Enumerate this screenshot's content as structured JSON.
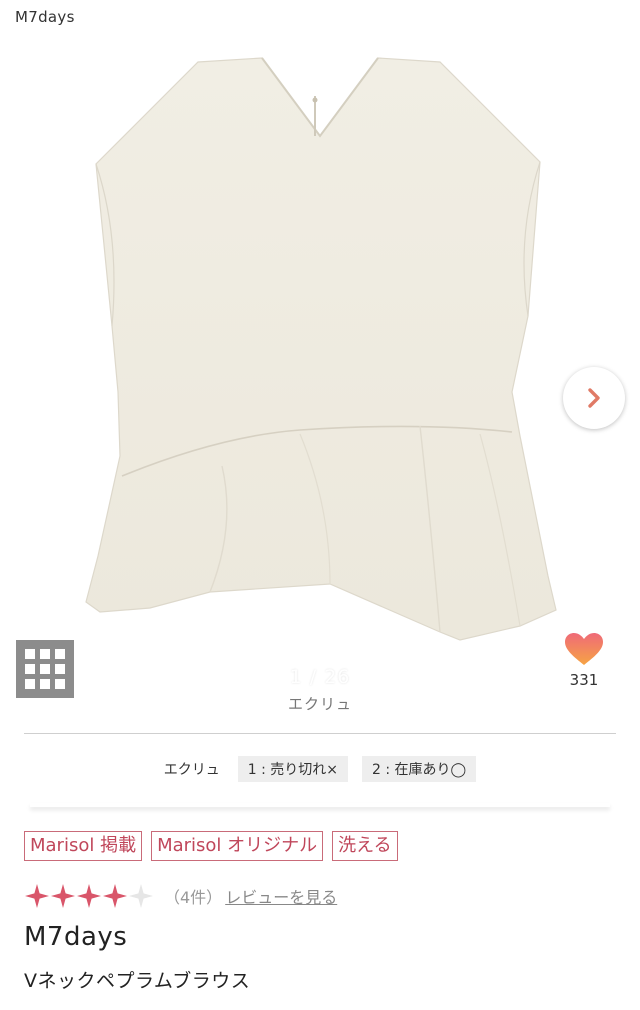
{
  "header": {
    "brand": "M7days"
  },
  "gallery": {
    "counter": "1 / 26",
    "next_icon": "chevron-right-icon",
    "grid_icon": "grid-view-icon"
  },
  "favorite": {
    "icon": "heart-icon",
    "count": "331"
  },
  "color": {
    "selected": "エクリュ"
  },
  "variants": {
    "color_label": "エクリュ",
    "sizes": [
      {
        "label": "1 : 売り切れ×"
      },
      {
        "label": "2 : 在庫あり◯"
      }
    ]
  },
  "tags": [
    "Marisol 掲載",
    "Marisol オリジナル",
    "洗える"
  ],
  "rating": {
    "stars": 4,
    "max_stars": 5,
    "count_text": "（4件）",
    "review_link": "レビューを見る"
  },
  "product": {
    "brand": "M7days",
    "name": "Vネックペプラムブラウス"
  },
  "colors": {
    "accent": "#c0475b",
    "star": "#d9566a",
    "heart_top": "#ef6a78",
    "heart_bottom": "#f6a444"
  }
}
